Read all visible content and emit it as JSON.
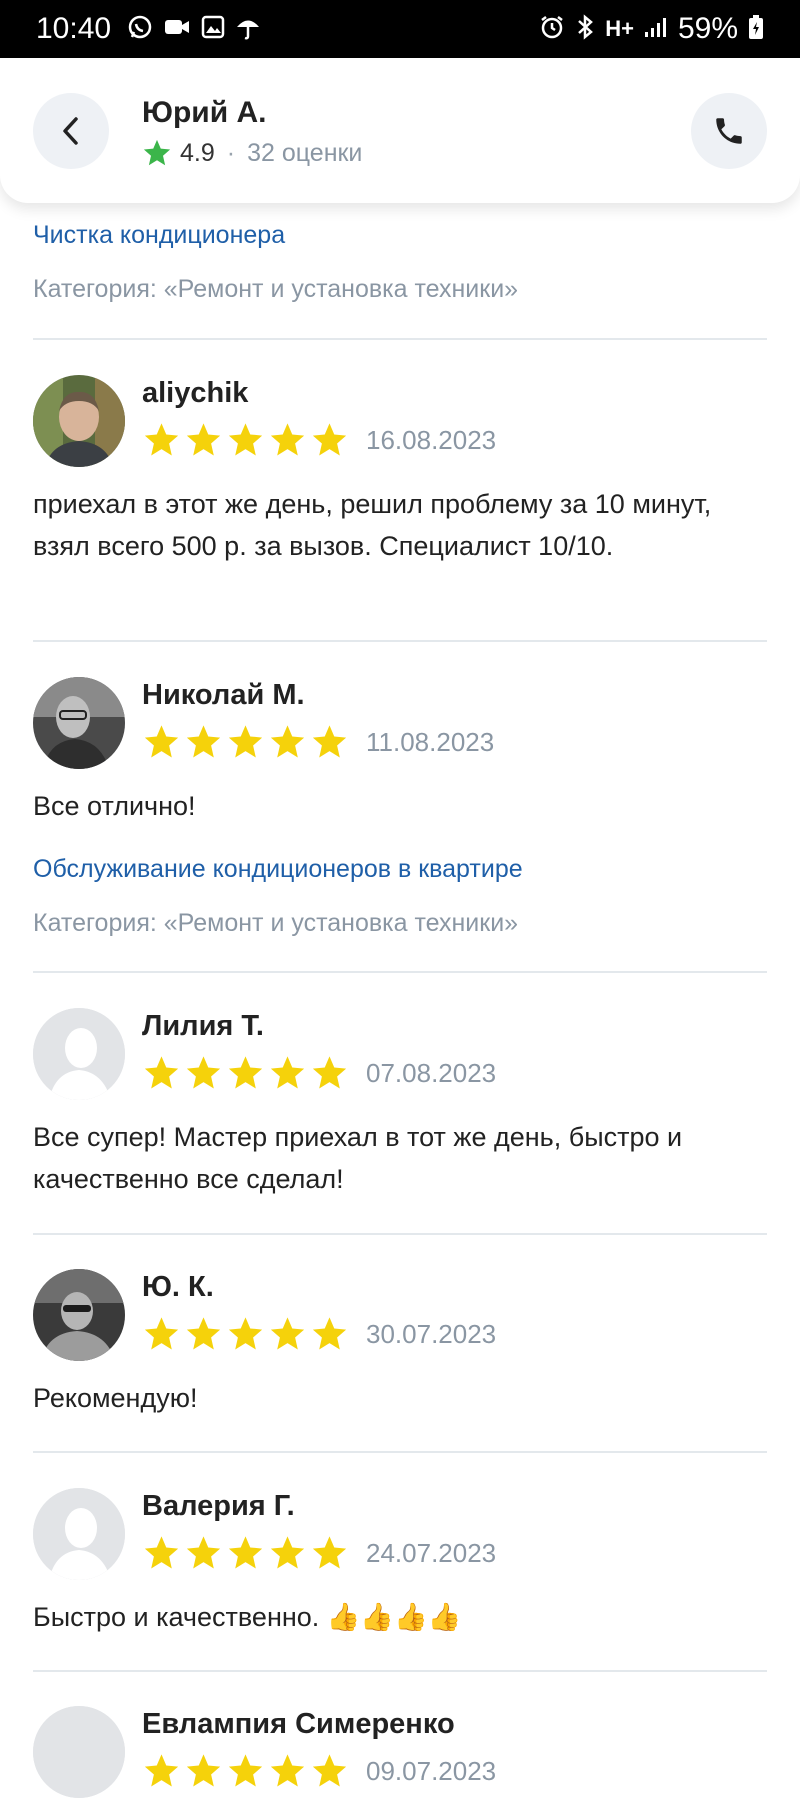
{
  "status_bar": {
    "time": "10:40",
    "network": "H+",
    "battery": "59%"
  },
  "header": {
    "name": "Юрий А.",
    "rating": "4.9",
    "separator": "·",
    "rating_count": "32 оценки"
  },
  "top_block": {
    "service": "Чистка кондиционера",
    "category": "Категория: «Ремонт и установка техники»"
  },
  "reviews": [
    {
      "author": "aliychik",
      "date": "16.08.2023",
      "stars": 5,
      "text": "приехал в этот же день, решил проблему за 10 минут, взял всего 500 р. за вызов. Специалист 10/10."
    },
    {
      "author": "Николай М.",
      "date": "11.08.2023",
      "stars": 5,
      "text": "Все отлично!",
      "service": "Обслуживание кондиционеров в квартире",
      "category": "Категория: «Ремонт и установка техники»"
    },
    {
      "author": "Лилия Т.",
      "date": "07.08.2023",
      "stars": 5,
      "text": "Все супер! Мастер приехал в тот же день, быстро и качественно все сделал!"
    },
    {
      "author": "Ю. К.",
      "date": "30.07.2023",
      "stars": 5,
      "text": "Рекомендую!"
    },
    {
      "author": "Валерия Г.",
      "date": "24.07.2023",
      "stars": 5,
      "text": "Быстро и качественно.",
      "emoji": "👍👍👍👍"
    },
    {
      "author": "Евлампия Симеренко",
      "date": "09.07.2023",
      "stars": 5
    }
  ],
  "colors": {
    "star": "#f5d20b",
    "rating_star": "#3bb54a",
    "link": "#1f5fa8",
    "muted": "#8a96a3"
  }
}
